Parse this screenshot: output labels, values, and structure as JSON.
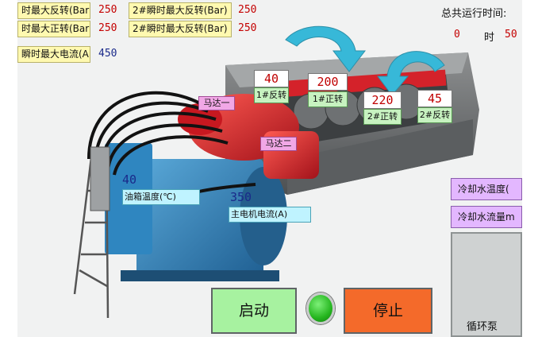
{
  "header": {
    "motor2_reverse_label": "2#瞬时最大反转(Bar)",
    "motor2_reverse_value": "250",
    "motor1_reverse_label": "时最大反转(Bar)",
    "motor1_reverse_value": "250",
    "motor1_forward_label": "时最大正转(Bar)",
    "motor1_forward_value": "250",
    "motor2_forward_label": "2#瞬时最大反转(Bar)",
    "motor2_forward_value": "250",
    "current_label": "瞬时最大电流(A)",
    "current_value": "450"
  },
  "runtime": {
    "title": "总共运行时间:",
    "hours": "0",
    "hour_unit": "时",
    "minutes": "50"
  },
  "machine": {
    "motor1_label": "马达一",
    "motor2_label": "马达二",
    "m1_reverse_value": "40",
    "m1_reverse_label": "1#反转",
    "m1_forward_value": "200",
    "m1_forward_label": "1#正转",
    "m2_forward_value": "220",
    "m2_forward_label": "2#正转",
    "m2_reverse_value": "45",
    "m2_reverse_label": "2#反转",
    "oil_temp_value": "40",
    "oil_temp_label": "油箱温度(℃)",
    "main_current_value": "350",
    "main_current_label": "主电机电流(A)"
  },
  "cooling": {
    "water_temp_label": "冷却水温度(",
    "water_flow_label": "冷却水流量m",
    "pump_label": "循环泵"
  },
  "controls": {
    "start_label": "启动",
    "stop_label": "停止"
  },
  "colors": {
    "run_lamp": "#25b61f",
    "stop_button": "#f46a2a",
    "start_button": "#a7f2a0",
    "machine_red": "#d4222a",
    "machine_blue": "#2f86c0",
    "flow_arrow": "#37b8d8"
  }
}
